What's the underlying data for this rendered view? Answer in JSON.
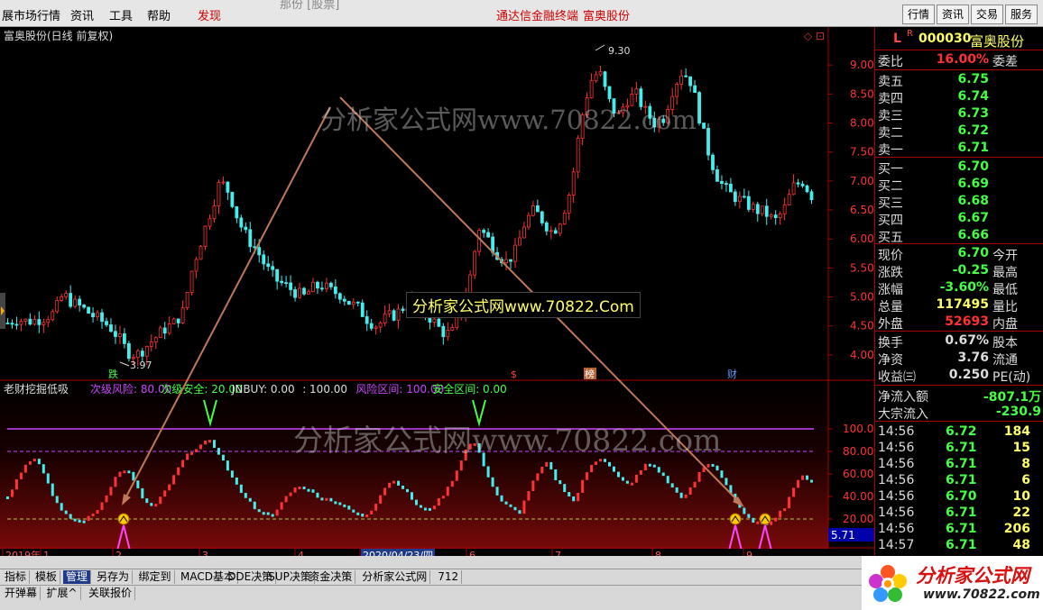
{
  "menu": {
    "items": [
      "展市场行情",
      "资讯",
      "工具",
      "帮助"
    ],
    "discover": "发现",
    "center_red": "通达信金融终端",
    "center_stock": "富奥股份",
    "center_partial": "那份 [股票]",
    "right_buttons": [
      "行情",
      "资讯",
      "交易",
      "服务"
    ]
  },
  "chart": {
    "title": "富奥股份(日线 前复权)",
    "ind_name": "老财挖掘低吸",
    "ind_params": [
      {
        "text": "次级风险: 80.00",
        "color": "#cc44ff"
      },
      {
        "text": "次级安全: 20.00",
        "color": "#44ff44"
      },
      {
        "text": "JNBUY: 0.00",
        "color": "#dddddd"
      },
      {
        "text": ": 100.00",
        "color": "#dddddd"
      },
      {
        "text": "风险区间: 100.00",
        "color": "#cc44ff"
      },
      {
        "text": "安全区间: 0.00",
        "color": "#44ff44"
      }
    ],
    "max_label": "9.30",
    "min_label": "3.97",
    "price_ticks": [
      "9.00",
      "8.50",
      "8.00",
      "7.50",
      "7.00",
      "6.50",
      "6.00",
      "5.50",
      "5.00",
      "4.50",
      "4.00"
    ],
    "ind_ticks": [
      "100.00",
      "80.00",
      "60.00",
      "40.00",
      "20.00"
    ],
    "cur_value": "5.71",
    "markers": [
      "跌",
      "$",
      "榜",
      "财"
    ],
    "x_labels": [
      "2019年",
      "1",
      "2",
      "3",
      "4",
      "2020/04/23/四",
      "6",
      "7",
      "8",
      "9"
    ],
    "period": "日线",
    "watermark1": "分析家公式网www.70822.com",
    "watermark2": "分析家公式网www.70822.com",
    "watermark_box": "分析家公式网www.70822.Com"
  },
  "chart_data": {
    "type": "candlestick",
    "price_range": [
      3.75,
      9.5
    ],
    "price_ticks": [
      9.0,
      8.5,
      8.0,
      7.5,
      7.0,
      6.5,
      6.0,
      5.5,
      5.0,
      4.5,
      4.0
    ],
    "close_series": [
      4.55,
      4.62,
      4.58,
      4.6,
      4.65,
      4.72,
      5.05,
      4.9,
      4.82,
      4.7,
      4.6,
      4.5,
      4.3,
      4.05,
      4.0,
      4.15,
      4.3,
      4.45,
      4.55,
      4.75,
      5.5,
      6.0,
      6.5,
      7.0,
      6.8,
      6.3,
      6.0,
      5.8,
      5.5,
      5.3,
      5.2,
      5.1,
      5.0,
      5.15,
      5.2,
      5.1,
      5.05,
      4.9,
      4.8,
      4.6,
      4.5,
      4.65,
      4.7,
      4.85,
      4.95,
      4.75,
      4.6,
      4.4,
      4.35,
      4.7,
      5.3,
      6.2,
      6.0,
      5.75,
      5.6,
      5.8,
      6.3,
      6.5,
      6.3,
      6.1,
      6.4,
      6.9,
      8.0,
      8.7,
      8.9,
      8.4,
      8.1,
      8.4,
      8.5,
      8.2,
      8.0,
      8.1,
      8.6,
      8.9,
      8.7,
      8.0,
      7.4,
      7.0,
      6.8,
      6.7,
      6.6,
      6.5,
      6.45,
      6.3,
      6.5,
      6.9,
      7.0,
      6.75
    ],
    "indicator": {
      "name": "老财挖掘低吸",
      "range": [
        0,
        100
      ],
      "ticks": [
        100,
        80,
        60,
        40,
        20
      ],
      "lines": {
        "risk": 100,
        "sub_risk": 80,
        "sub_safe": 20
      },
      "values": [
        40,
        55,
        70,
        75,
        60,
        40,
        25,
        20,
        18,
        22,
        30,
        45,
        60,
        65,
        50,
        35,
        30,
        42,
        55,
        70,
        80,
        85,
        90,
        80,
        65,
        50,
        40,
        30,
        25,
        22,
        35,
        45,
        50,
        45,
        40,
        38,
        35,
        30,
        25,
        22,
        30,
        45,
        55,
        50,
        40,
        30,
        28,
        35,
        45,
        60,
        80,
        90,
        70,
        50,
        35,
        30,
        25,
        45,
        60,
        70,
        55,
        45,
        35,
        55,
        70,
        75,
        65,
        55,
        50,
        60,
        70,
        65,
        55,
        45,
        38,
        50,
        65,
        70,
        60,
        45,
        30,
        20,
        17,
        15,
        22,
        30,
        48,
        58,
        54
      ]
    }
  },
  "quote": {
    "code_prefix": "L",
    "code_sup": "R",
    "code": "000030",
    "name": "富奥股份",
    "weibi_label": "委比",
    "weibi_value": "16.00%",
    "weicha_label": "委差",
    "sell": [
      {
        "label": "卖五",
        "price": "6.75"
      },
      {
        "label": "卖四",
        "price": "6.74"
      },
      {
        "label": "卖三",
        "price": "6.73"
      },
      {
        "label": "卖二",
        "price": "6.72"
      },
      {
        "label": "卖一",
        "price": "6.71"
      }
    ],
    "buy": [
      {
        "label": "买一",
        "price": "6.70"
      },
      {
        "label": "买二",
        "price": "6.69"
      },
      {
        "label": "买三",
        "price": "6.68"
      },
      {
        "label": "买四",
        "price": "6.67"
      },
      {
        "label": "买五",
        "price": "6.66"
      }
    ],
    "stats": [
      {
        "label": "现价",
        "value": "6.70",
        "label2": "今开",
        "color": "#44ff44"
      },
      {
        "label": "涨跌",
        "value": "-0.25",
        "label2": "最高",
        "color": "#44ff44"
      },
      {
        "label": "涨幅",
        "value": "-3.60%",
        "label2": "最低",
        "color": "#44ff44"
      },
      {
        "label": "总量",
        "value": "117495",
        "label2": "量比",
        "color": "#ffff66"
      },
      {
        "label": "外盘",
        "value": "52693",
        "label2": "内盘",
        "color": "#ff3333"
      }
    ],
    "stats2": [
      {
        "label": "换手",
        "value": "0.67%",
        "label2": "股本"
      },
      {
        "label": "净资",
        "value": "3.76",
        "label2": "流通"
      },
      {
        "label": "收益㈢",
        "value": "0.250",
        "label2": "PE(动)"
      }
    ],
    "flows": [
      {
        "label": "净流入额",
        "value": "-807.1万"
      },
      {
        "label": "大宗流入",
        "value": "-230.9"
      }
    ],
    "ticks": [
      {
        "time": "14:56",
        "price": "6.72",
        "vol": "184"
      },
      {
        "time": "14:56",
        "price": "6.71",
        "vol": "15"
      },
      {
        "time": "14:56",
        "price": "6.71",
        "vol": "8"
      },
      {
        "time": "14:56",
        "price": "6.71",
        "vol": "6"
      },
      {
        "time": "14:56",
        "price": "6.70",
        "vol": "10"
      },
      {
        "time": "14:56",
        "price": "6.71",
        "vol": "22"
      },
      {
        "time": "14:56",
        "price": "6.71",
        "vol": "206"
      },
      {
        "time": "14:57",
        "price": "6.71",
        "vol": "48"
      }
    ]
  },
  "bottom": {
    "tabs1": [
      "指标",
      "模板",
      "管理",
      "另存为",
      "绑定到",
      "MACD基本",
      "DDE决策",
      "SUP决策",
      "资金决策",
      "分析家公式网",
      "712"
    ],
    "tabs2": [
      "开弹幕",
      "扩展^",
      "关联报价"
    ]
  },
  "logo": {
    "line1": "分析家公式网",
    "line2": "www.70822.com"
  }
}
